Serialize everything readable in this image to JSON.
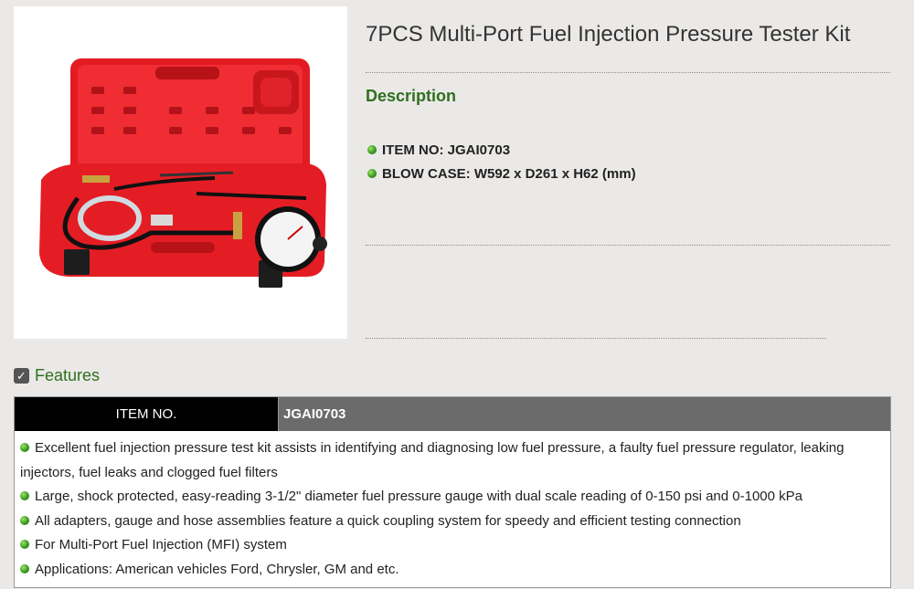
{
  "product": {
    "title": "7PCS Multi-Port Fuel Injection Pressure Tester Kit",
    "image_alt": "fuel-injection-tester-kit-photo"
  },
  "description": {
    "heading": "Description",
    "specs": [
      "ITEM NO: JGAI0703",
      "BLOW CASE: W592 x D261 x H62 (mm)"
    ]
  },
  "features": {
    "heading": "Features",
    "checked": true,
    "table_header": {
      "item_label": "ITEM NO.",
      "item_value": "JGAI0703"
    },
    "items": [
      "Excellent fuel injection pressure test kit assists in identifying and diagnosing low fuel pressure, a faulty fuel pressure regulator, leaking injectors, fuel leaks and clogged fuel filters",
      "Large, shock protected, easy-reading 3-1/2\" diameter fuel pressure gauge with dual scale reading of 0-150 psi and 0-1000 kPa",
      "All adapters, gauge and hose assemblies feature a quick coupling system for speedy and efficient testing connection",
      "For Multi-Port Fuel Injection (MFI) system",
      "Applications: American vehicles Ford, Chrysler, GM and etc."
    ]
  },
  "colors": {
    "accent_green": "#2f6f1e",
    "header_black": "#000000",
    "header_gray": "#6b6b6b",
    "case_red": "#e8202a"
  }
}
